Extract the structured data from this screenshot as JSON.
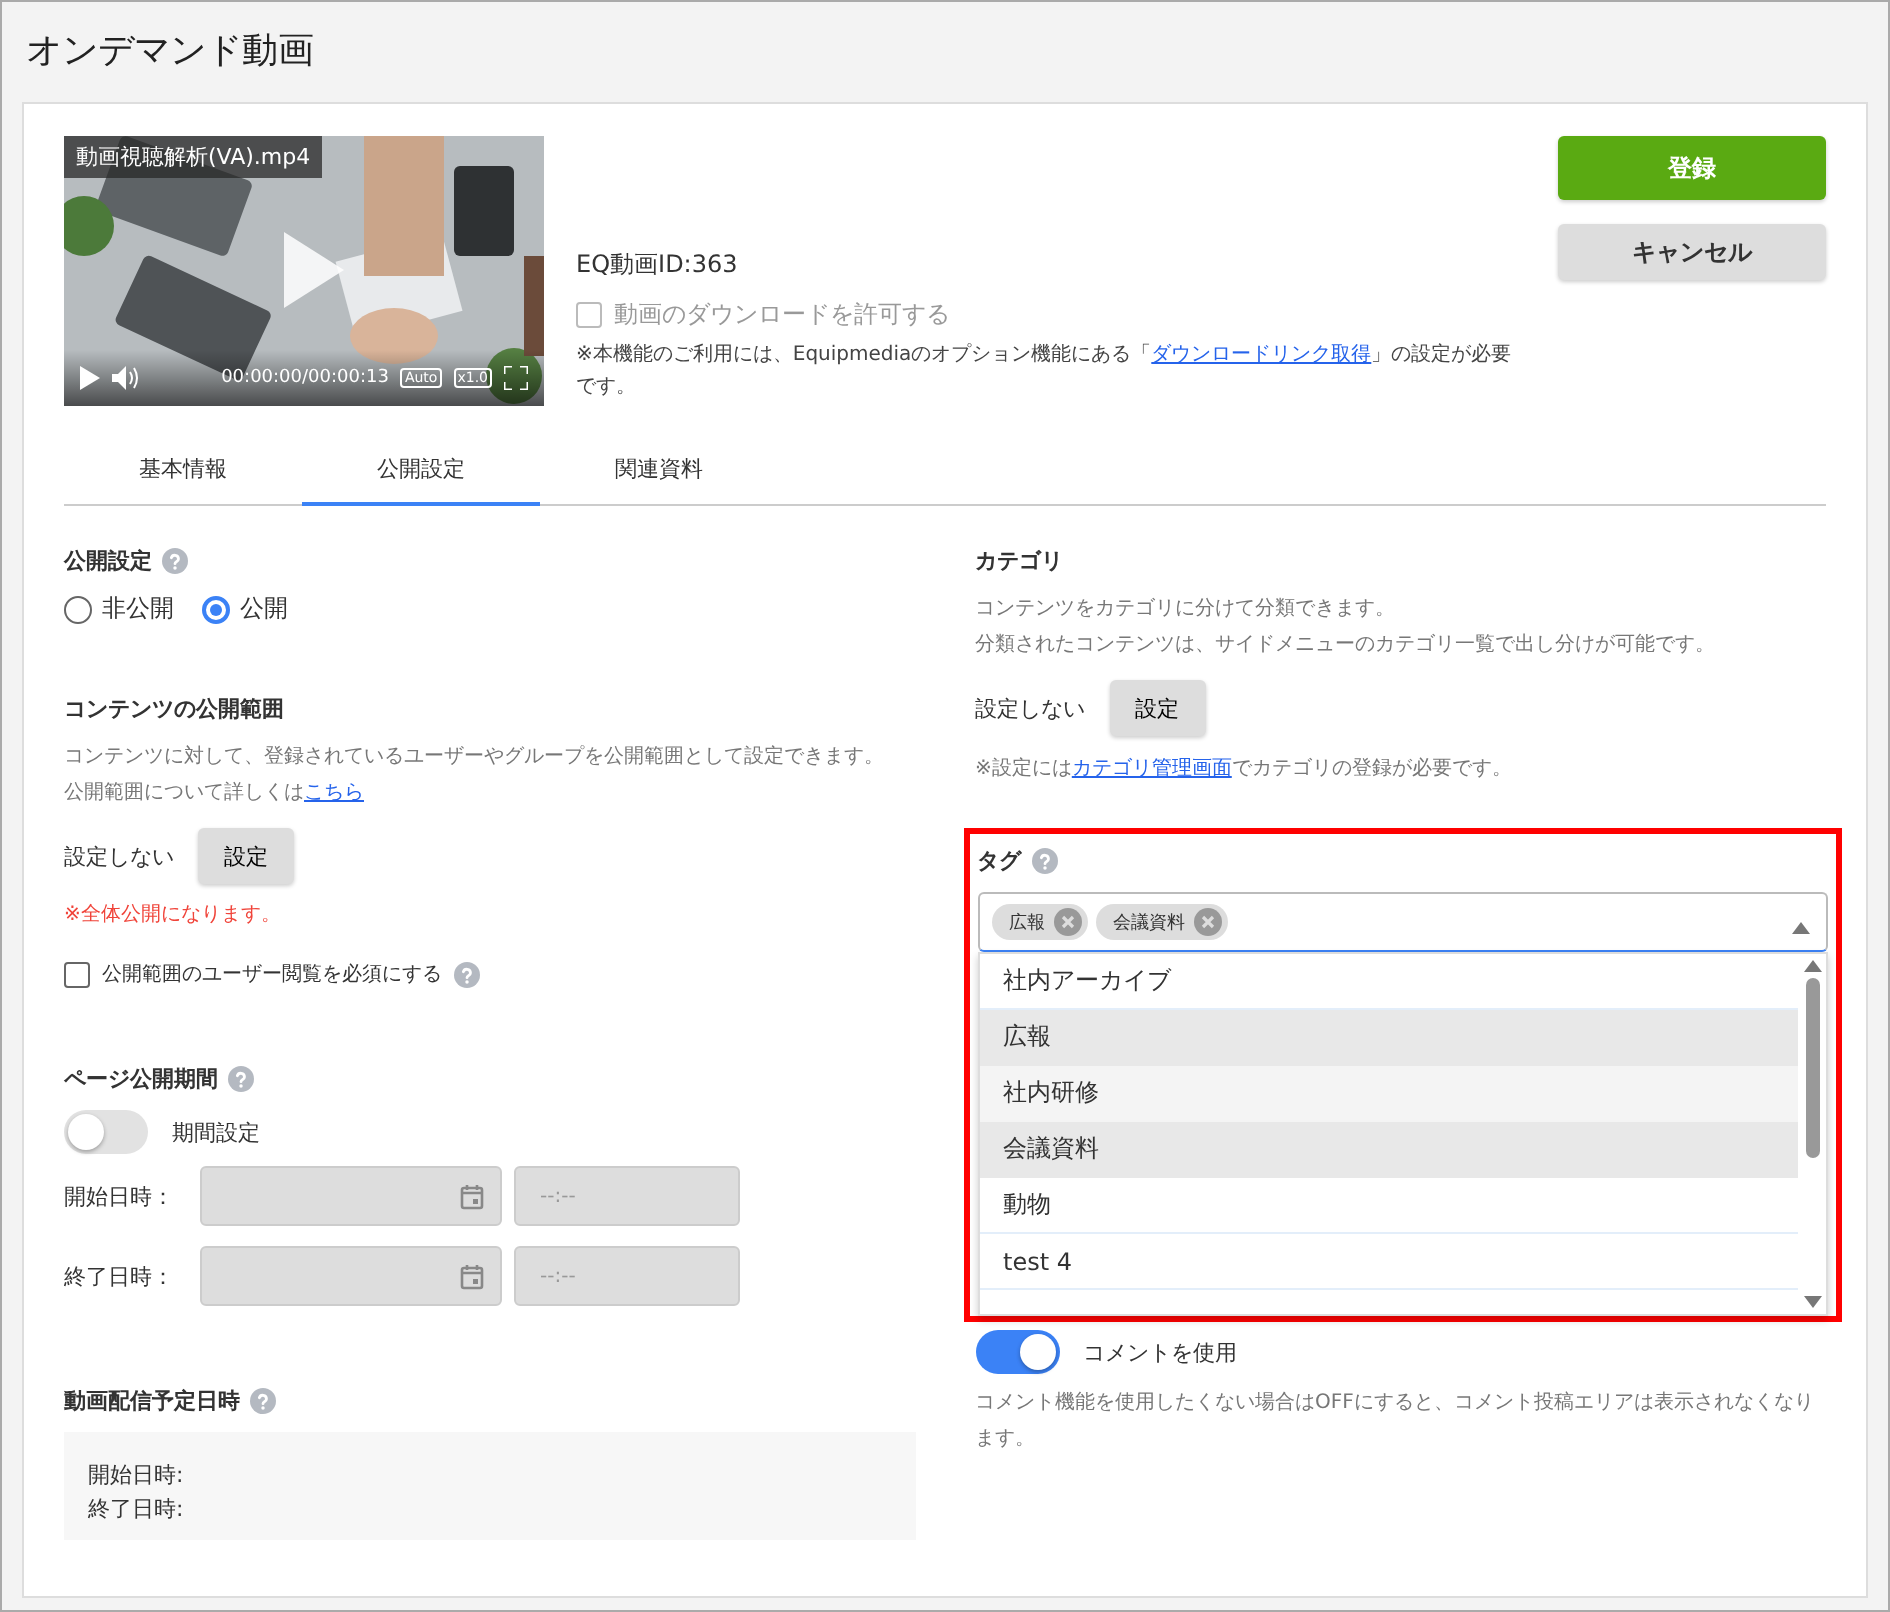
{
  "page_title": "オンデマンド動画",
  "video": {
    "title": "動画視聴解析(VA).mp4",
    "time": "00:00:00/00:00:13",
    "quality": "Auto",
    "speed": "x1.0"
  },
  "video_id": "EQ動画ID:363",
  "download": {
    "label": "動画のダウンロードを許可する",
    "checked": false,
    "note_before": "※本機能のご利用には、Equipmediaのオプション機能にある「",
    "note_link": "ダウンロードリンク取得",
    "note_after": "」の設定が必要です。"
  },
  "buttons": {
    "register": "登録",
    "cancel": "キャンセル"
  },
  "tabs": [
    {
      "label": "基本情報",
      "selected": false
    },
    {
      "label": "公開設定",
      "selected": true
    },
    {
      "label": "関連資料",
      "selected": false
    }
  ],
  "publish": {
    "label": "公開設定",
    "options": [
      {
        "label": "非公開",
        "selected": false
      },
      {
        "label": "公開",
        "selected": true
      }
    ]
  },
  "scope": {
    "title": "コンテンツの公開範囲",
    "description": "コンテンツに対して、登録されているユーザーやグループを公開範囲として設定できます。",
    "more_before": "公開範囲について詳しくは",
    "more_link": "こちら",
    "value": "設定しない",
    "button": "設定",
    "warning": "※全体公開になります。",
    "require": {
      "label": "公開範囲のユーザー閲覧を必須にする",
      "checked": false
    }
  },
  "period": {
    "title": "ページ公開期間",
    "toggle": {
      "label": "期間設定",
      "on": false
    },
    "rows": [
      {
        "label": "開始日時：",
        "time_placeholder": "--:--"
      },
      {
        "label": "終了日時：",
        "time_placeholder": "--:--"
      }
    ]
  },
  "schedule": {
    "title": "動画配信予定日時",
    "lines": [
      "開始日時:",
      "終了日時:"
    ]
  },
  "category": {
    "title": "カテゴリ",
    "description": [
      "コンテンツをカテゴリに分けて分類できます。",
      "分類されたコンテンツは、サイドメニューのカテゴリ一覧で出し分けが可能です。"
    ],
    "value": "設定しない",
    "button": "設定",
    "note_before": "※設定には",
    "note_link": "カテゴリ管理画面",
    "note_after": "でカテゴリの登録が必要です。"
  },
  "tags": {
    "label": "タグ",
    "expanded": true,
    "chips": [
      "広報",
      "会議資料"
    ],
    "options": [
      {
        "label": "社内アーカイブ",
        "selected": false,
        "hovered": false
      },
      {
        "label": "広報",
        "selected": true,
        "hovered": false
      },
      {
        "label": "社内研修",
        "selected": false,
        "hovered": true
      },
      {
        "label": "会議資料",
        "selected": true,
        "hovered": false
      },
      {
        "label": "動物",
        "selected": false,
        "hovered": false
      },
      {
        "label": "test 4",
        "selected": false,
        "hovered": false
      }
    ]
  },
  "comment": {
    "toggle": {
      "label": "コメントを使用",
      "on": true
    },
    "description": "コメント機能を使用したくない場合はOFFにすると、コメント投稿エリアは表示されなくなります。"
  }
}
